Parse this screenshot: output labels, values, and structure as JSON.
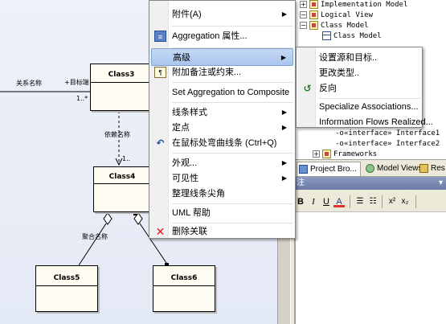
{
  "diagram": {
    "classes": [
      {
        "id": "class3",
        "name": "Class3"
      },
      {
        "id": "class4",
        "name": "Class4"
      },
      {
        "id": "class5",
        "name": "Class5"
      },
      {
        "id": "class6",
        "name": "Class6"
      }
    ],
    "labels": {
      "relation_name": "关系名称",
      "target_role": "+目标端",
      "target_mult": "1..*",
      "dependency_name": "依赖名称",
      "dependency_mult": "1..",
      "aggregation_name": "聚合名称"
    }
  },
  "context_menu": {
    "items": [
      {
        "label": "附件(A)",
        "submenu": true,
        "icon": ""
      },
      {
        "label": "Aggregation 属性...",
        "submenu": false,
        "icon": "properties-icon"
      },
      {
        "label": "高级",
        "submenu": true,
        "icon": "",
        "highlighted": true
      },
      {
        "label": "附加备注或约束...",
        "submenu": false,
        "icon": "note-icon"
      },
      {
        "label": "Set Aggregation to Composite",
        "submenu": false,
        "icon": ""
      },
      {
        "label": "线条样式",
        "submenu": true,
        "icon": ""
      },
      {
        "label": "定点",
        "submenu": true,
        "icon": ""
      },
      {
        "label": "在鼠标处弯曲线条 (Ctrl+Q)",
        "submenu": false,
        "icon": "bend-line-icon"
      },
      {
        "label": "外观...",
        "submenu": true,
        "icon": ""
      },
      {
        "label": "可见性",
        "submenu": true,
        "icon": ""
      },
      {
        "label": "整理线条尖角",
        "submenu": false,
        "icon": ""
      },
      {
        "label": "UML 帮助",
        "submenu": false,
        "icon": ""
      },
      {
        "label": "删除关联",
        "submenu": false,
        "icon": "delete-icon"
      }
    ]
  },
  "advanced_submenu": {
    "items": [
      {
        "label": "设置源和目标..",
        "icon": ""
      },
      {
        "label": "更改类型..",
        "icon": ""
      },
      {
        "label": "反向",
        "icon": "reverse-icon"
      },
      {
        "label": "Specialize Associations...",
        "icon": ""
      },
      {
        "label": "Information Flows Realized...",
        "icon": ""
      }
    ]
  },
  "tree": {
    "items": [
      {
        "label": "Implementation Model",
        "type": "package"
      },
      {
        "label": "Logical View",
        "type": "package"
      },
      {
        "label": "Class Model",
        "type": "package"
      },
      {
        "label": "Class Model",
        "type": "diagram"
      },
      {
        "label": "«interface» Interface1",
        "type": "interface"
      },
      {
        "label": "«interface» Interface2",
        "type": "interface"
      },
      {
        "label": "Frameworks",
        "type": "package"
      }
    ]
  },
  "tabs": [
    {
      "label": "Project Bro...",
      "icon": "project-browser-icon"
    },
    {
      "label": "Model Views",
      "icon": "model-views-icon"
    },
    {
      "label": "Res",
      "icon": "resources-icon"
    }
  ],
  "notes": {
    "header": "注",
    "toolbar": [
      "B",
      "I",
      "U",
      "A"
    ]
  },
  "colors": {
    "highlight": "#a9c5ee",
    "delete_icon": "#d02020",
    "canvas_bg": "#e8ecf7",
    "class_fill": "#fffdf2"
  }
}
